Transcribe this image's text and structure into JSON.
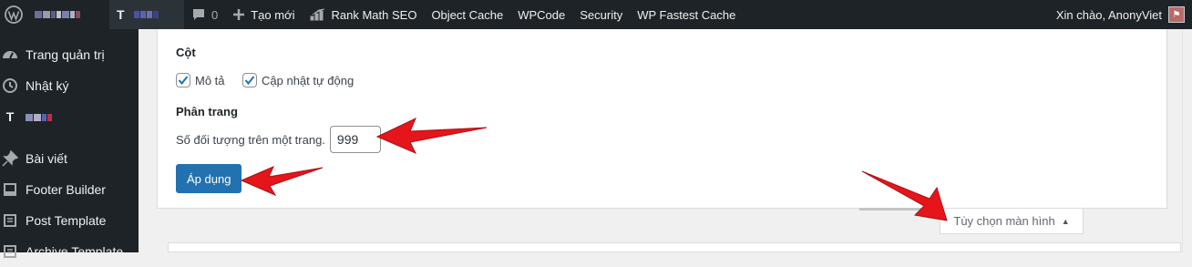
{
  "adminbar": {
    "comments_count": "0",
    "new_label": "Tạo mới",
    "items": [
      "Rank Math SEO",
      "Object Cache",
      "WPCode",
      "Security",
      "WP Fastest Cache"
    ],
    "greeting": "Xin chào, AnonyViet"
  },
  "sidebar": {
    "items": [
      {
        "label": "Trang quản trị",
        "icon": "dashboard-icon"
      },
      {
        "label": "Nhật ký",
        "icon": "history-icon"
      },
      {
        "label": "",
        "icon": "plugin-logo-icon"
      },
      {
        "label": "Bài viết",
        "icon": "pin-icon"
      },
      {
        "label": "Footer Builder",
        "icon": "layout-icon"
      },
      {
        "label": "Post Template",
        "icon": "layout-icon"
      },
      {
        "label": "Archive Template",
        "icon": "layout-icon"
      }
    ]
  },
  "screen_options": {
    "columns_legend": "Cột",
    "columns": [
      {
        "label": "Mô tả",
        "checked": true
      },
      {
        "label": "Cập nhật tự động",
        "checked": true
      }
    ],
    "pagination_legend": "Phân trang",
    "per_page_label": "Số đối tượng trên một trang.",
    "per_page_value": "999",
    "apply_label": "Áp dụng",
    "toggle_label": "Tùy chọn màn hình"
  },
  "colors": {
    "adminbar_bg": "#1d2327",
    "primary": "#2271b1",
    "annotation_arrow": "#e4161b"
  }
}
